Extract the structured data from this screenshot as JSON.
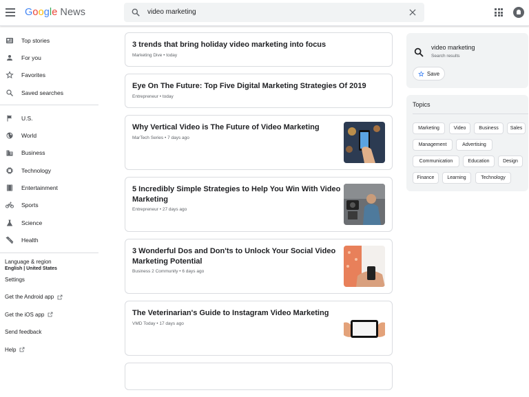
{
  "header": {
    "logo_google": "Google",
    "logo_news": "News",
    "search_value": "video marketing"
  },
  "sidebar": {
    "items": [
      {
        "label": "Top stories",
        "icon": "top-stories-icon"
      },
      {
        "label": "For you",
        "icon": "person-icon"
      },
      {
        "label": "Favorites",
        "icon": "star-icon"
      },
      {
        "label": "Saved searches",
        "icon": "search-icon"
      }
    ],
    "sections": [
      {
        "label": "U.S.",
        "icon": "flag-icon"
      },
      {
        "label": "World",
        "icon": "globe-icon"
      },
      {
        "label": "Business",
        "icon": "business-icon"
      },
      {
        "label": "Technology",
        "icon": "chip-icon"
      },
      {
        "label": "Entertainment",
        "icon": "film-icon"
      },
      {
        "label": "Sports",
        "icon": "bike-icon"
      },
      {
        "label": "Science",
        "icon": "flask-icon"
      },
      {
        "label": "Health",
        "icon": "health-icon"
      }
    ],
    "language_label": "Language & region",
    "language_value": "English | United States",
    "settings": "Settings",
    "android": "Get the Android app",
    "ios": "Get the iOS app",
    "feedback": "Send feedback",
    "help": "Help"
  },
  "articles": [
    {
      "title": "3 trends that bring holiday video marketing into focus",
      "source": "Marketing Dive",
      "time": "today"
    },
    {
      "title": "Eye On The Future: Top Five Digital Marketing Strategies Of 2019",
      "source": "Entrepreneur",
      "time": "today"
    },
    {
      "title": "Why Vertical Video is The Future of Video Marketing",
      "source": "MarTech Series",
      "time": "7 days ago"
    },
    {
      "title_line1": "5 Incredibly Simple Strategies to Help You Win With Video",
      "title_line2": "Marketing",
      "source": "Entrepreneur",
      "time": "27 days ago"
    },
    {
      "title_line1": "3 Wonderful Dos and Don'ts to Unlock Your Social Video",
      "title_line2": "Marketing Potential",
      "source": "Business 2 Community",
      "time": "6 days ago"
    },
    {
      "title": "The Veterinarian's Guide to Instagram Video Marketing",
      "source": "VMD Today",
      "time": "17 days ago"
    }
  ],
  "meta_separator": "•",
  "right": {
    "search_title": "video marketing",
    "search_sub": "Search results",
    "save_label": "Save",
    "topics_title": "Topics",
    "topics": [
      "Marketing",
      "Video",
      "Business",
      "Sales",
      "Management",
      "Advertising",
      "Communication",
      "Education",
      "Design",
      "Finance",
      "Learning",
      "Technology"
    ]
  },
  "colors": {
    "accent": "#4285f4",
    "text": "#202124",
    "muted": "#5f6368",
    "border": "#dadce0",
    "panel": "#f1f3f4"
  }
}
